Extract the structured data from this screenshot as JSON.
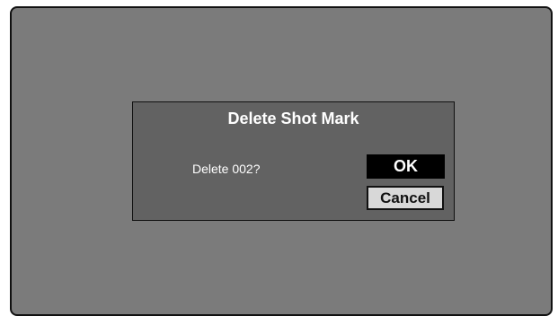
{
  "dialog": {
    "title": "Delete Shot Mark",
    "message": "Delete 002?",
    "ok_label": "OK",
    "cancel_label": "Cancel"
  },
  "colors": {
    "screen_background": "#7b7b7b",
    "dialog_background": "#626262",
    "ok_button_background": "#000000",
    "cancel_button_background": "#d8d8d8"
  }
}
